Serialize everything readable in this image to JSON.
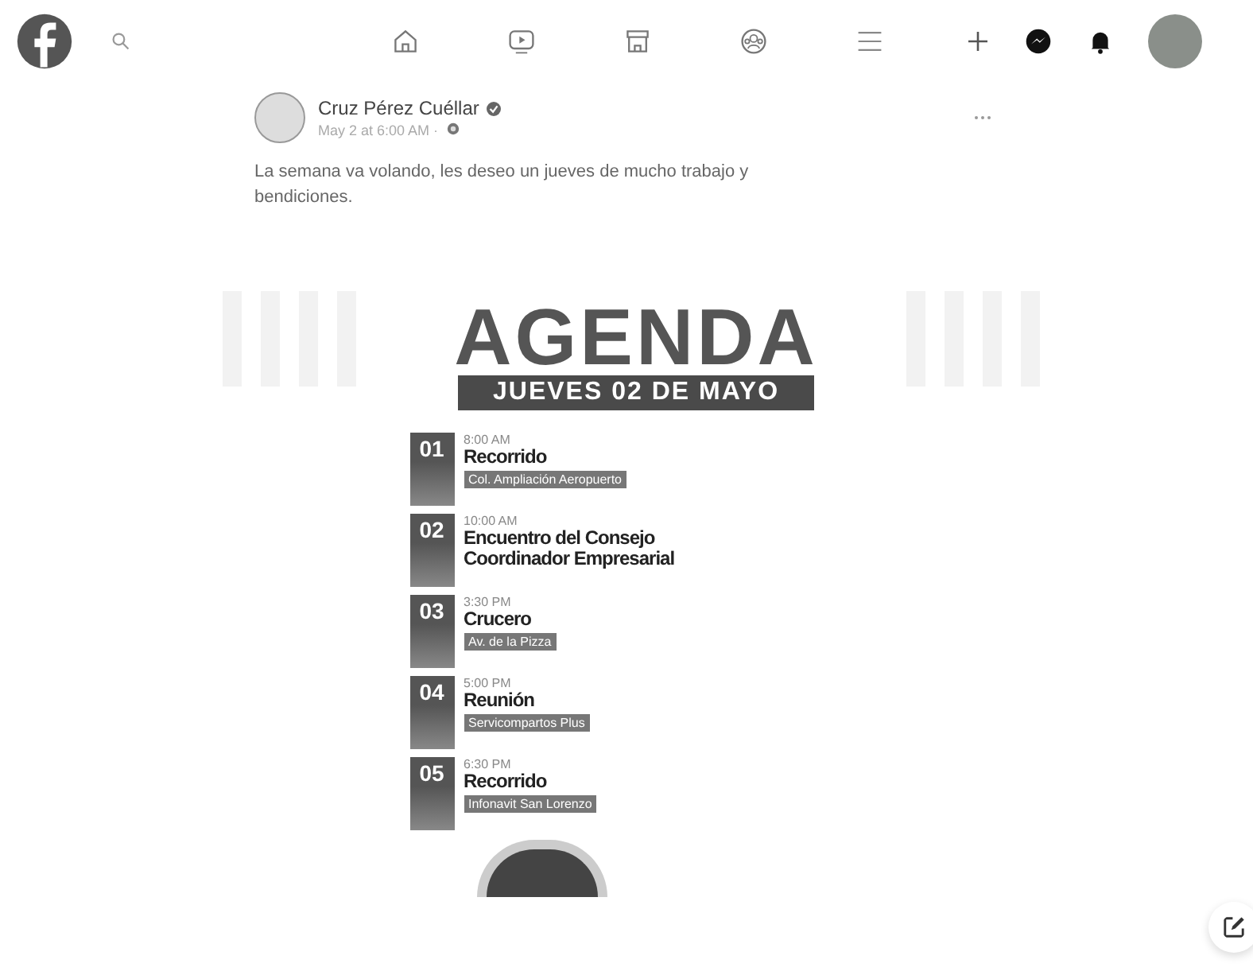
{
  "post": {
    "author": "Cruz Pérez Cuéllar",
    "timestamp": "May 2 at 6:00 AM ·",
    "text": "La semana va volando, les deseo un jueves de mucho trabajo y bendiciones."
  },
  "agenda": {
    "title": "AGENDA",
    "date": "JUEVES 02 DE MAYO",
    "items": [
      {
        "number": "01",
        "time": "8:00 AM",
        "title": "Recorrido",
        "location": "Col. Ampliación Aeropuerto"
      },
      {
        "number": "02",
        "time": "10:00 AM",
        "title": "Encuentro del Consejo Coordinador Empresarial"
      },
      {
        "number": "03",
        "time": "3:30 PM",
        "title": "Crucero",
        "location": "Av. de la Pizza"
      },
      {
        "number": "04",
        "time": "5:00 PM",
        "title": "Reunión",
        "location": "Servicompartos Plus"
      },
      {
        "number": "05",
        "time": "6:30 PM",
        "title": "Recorrido",
        "location": "Infonavit San Lorenzo"
      }
    ]
  }
}
